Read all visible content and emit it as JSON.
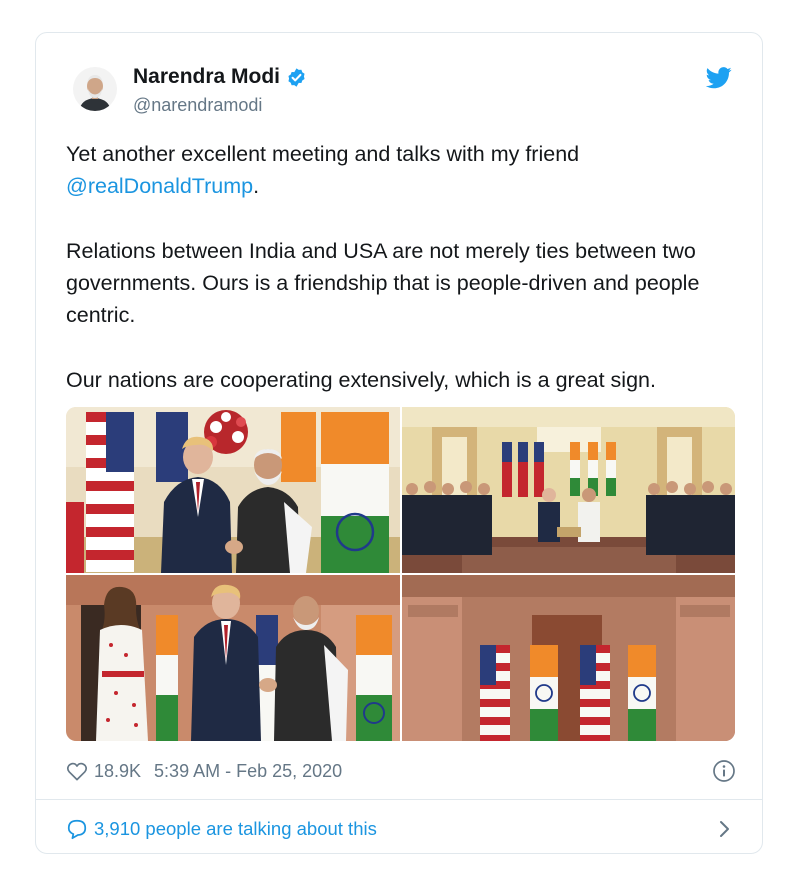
{
  "tweet": {
    "author_name": "Narendra Modi",
    "handle": "@narendramodi",
    "verified_icon": "verified-badge-icon",
    "logo_icon": "twitter-bird-icon",
    "text_p1_before": "Yet another excellent meeting and talks with my friend",
    "mention": "@realDonaldTrump",
    "text_p1_after": ".",
    "text_p2": "Relations between India and USA are not merely ties between two governments. Ours is a friendship that is people-driven and people centric.",
    "text_p3": "Our nations are cooperating extensively, which is a great sign.",
    "likes": "18.9K",
    "timestamp": "5:39 AM - Feb 25, 2020",
    "talking": "3,910 people are talking about this"
  },
  "colors": {
    "link": "#1b95e0",
    "muted": "#657786",
    "border": "#e1e8ed",
    "text": "#14171a"
  }
}
